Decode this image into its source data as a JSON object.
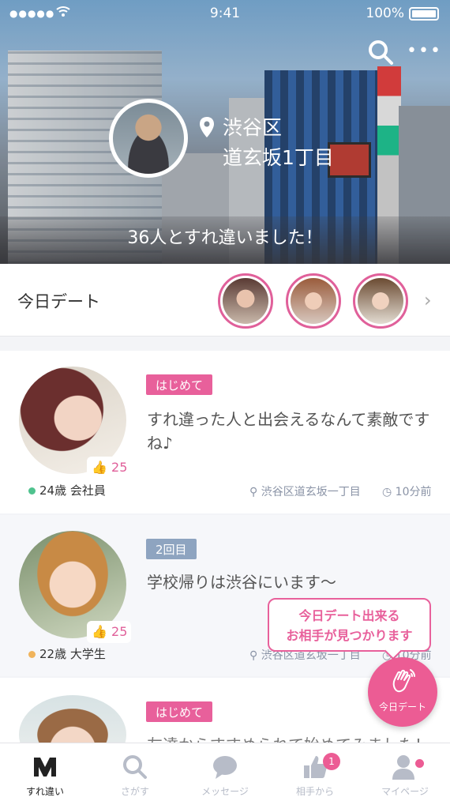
{
  "status_bar": {
    "signal": "●●●●●",
    "time": "9:41",
    "battery": "100%"
  },
  "header": {
    "more_label": "•••",
    "location_line1": "渋谷区",
    "location_line2": "道玄坂1丁目",
    "passed_text": "36人とすれ違いました！"
  },
  "today_date": {
    "title": "今日デート"
  },
  "list": [
    {
      "badge": "はじめて",
      "message": "すれ違った人と出会えるなんて素敵ですね♪",
      "likes": "25",
      "age_job": "24歳 会社員",
      "place": "渋谷区道玄坂一丁目",
      "time_ago": "10分前",
      "online_color": "#4fc28e"
    },
    {
      "badge": "2回目",
      "message": "学校帰りは渋谷にいます〜",
      "likes": "25",
      "age_job": "22歳 大学生",
      "place": "渋谷区道玄坂一丁目",
      "time_ago": "10分前",
      "online_color": "#f0b45c"
    },
    {
      "badge": "はじめて",
      "message": "友達からすすめられて始めてみました！"
    }
  ],
  "tooltip": {
    "line1": "今日デート出来る",
    "line2": "お相手が見つかります"
  },
  "fab": {
    "label": "今日デート"
  },
  "tabbar": {
    "tabs": [
      {
        "label": "すれ違い",
        "icon": "passing-icon"
      },
      {
        "label": "さがす",
        "icon": "search-icon"
      },
      {
        "label": "メッセージ",
        "icon": "chat-icon"
      },
      {
        "label": "相手から",
        "icon": "thumbs-up-icon",
        "badge": "1"
      },
      {
        "label": "マイページ",
        "icon": "user-icon"
      }
    ]
  },
  "colors": {
    "accent": "#ec5c94",
    "second_badge": "#8ea4c0",
    "text_muted": "#8a93a6"
  }
}
